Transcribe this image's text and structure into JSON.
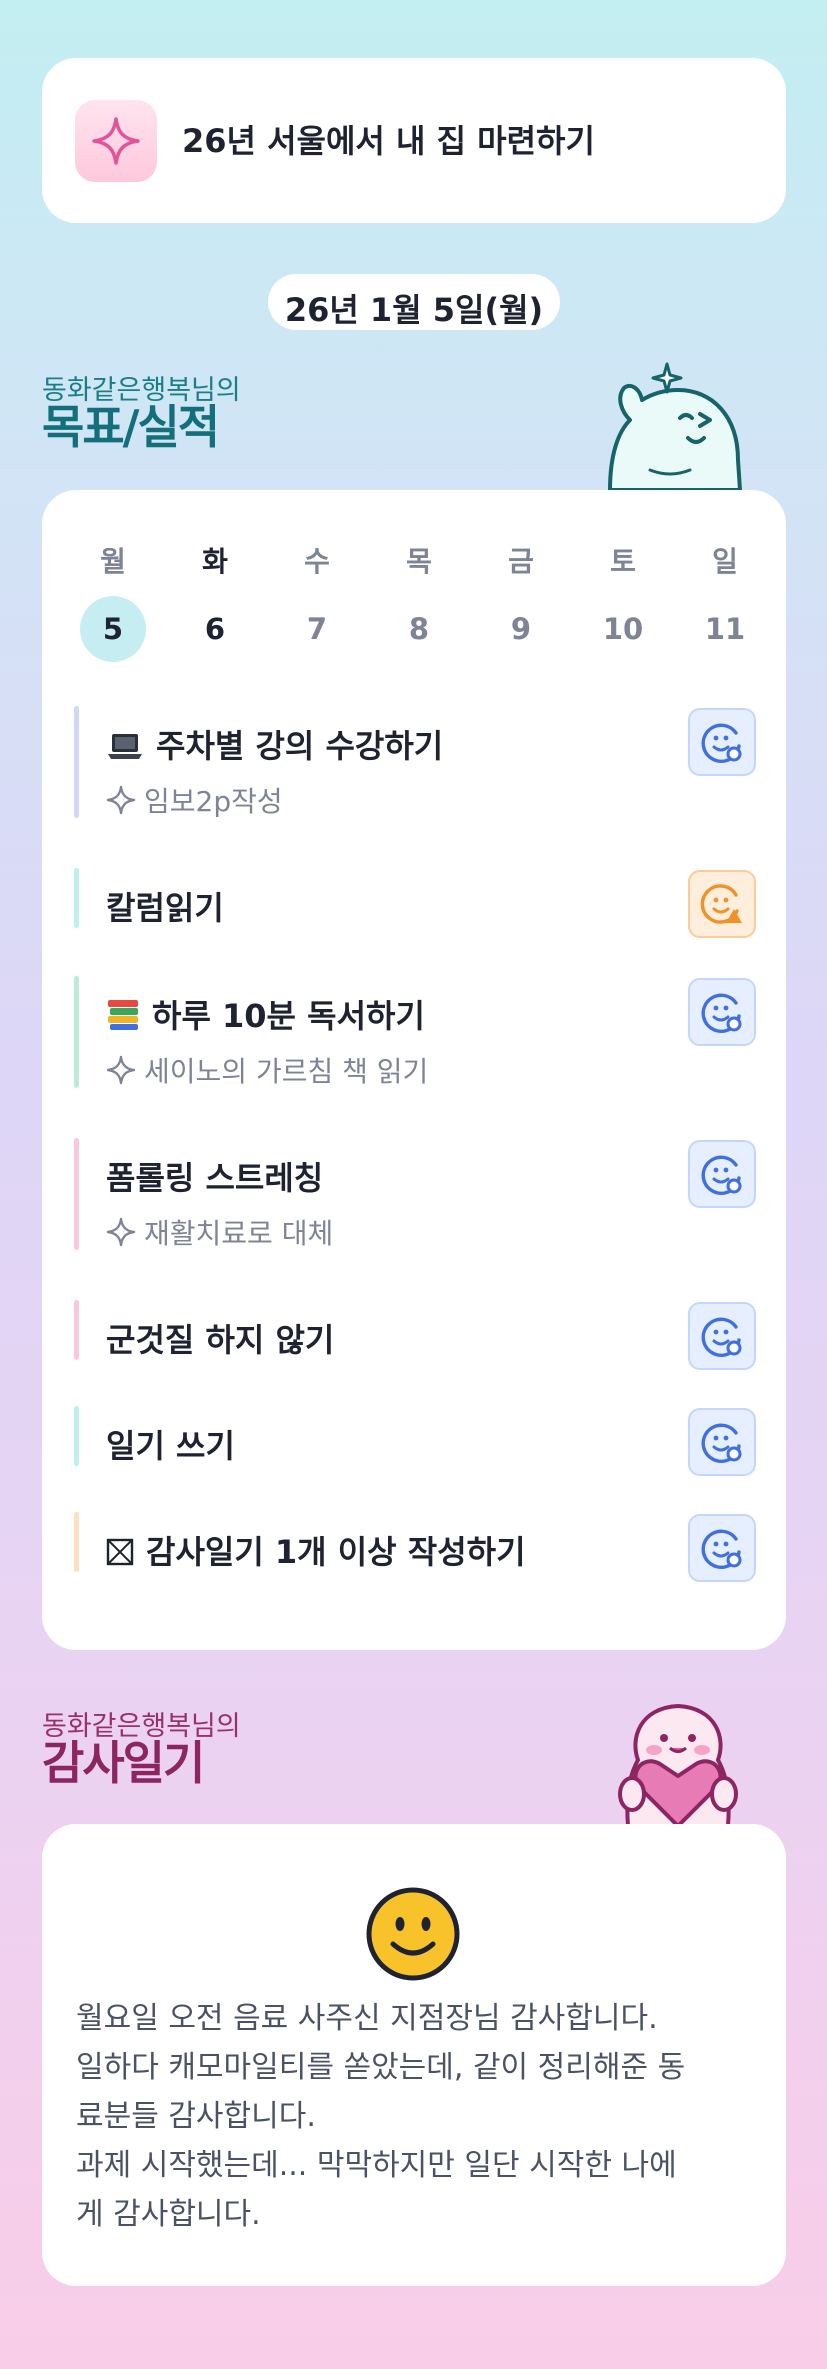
{
  "goal": {
    "title": "26년 서울에서 내 집 마련하기",
    "icon": "sparkle-icon"
  },
  "date": "26년 1월 5일(월)",
  "goals_section": {
    "subtitle": "동화같은행복님의",
    "title": "목표/실적"
  },
  "week": {
    "days": [
      {
        "label": "월",
        "date": "5",
        "selected": true
      },
      {
        "label": "화",
        "date": "6",
        "today": true
      },
      {
        "label": "수",
        "date": "7"
      },
      {
        "label": "목",
        "date": "8"
      },
      {
        "label": "금",
        "date": "9"
      },
      {
        "label": "토",
        "date": "10"
      },
      {
        "label": "일",
        "date": "11"
      }
    ]
  },
  "tasks": [
    {
      "title": "주차별 강의 수강하기",
      "lead_icon": "laptop-icon",
      "subtitle": "임보2p작성",
      "bar_color": "#cfd9f6",
      "status": "done-smile-icon",
      "status_color": "#3f6fe0"
    },
    {
      "title": "칼럼읽기",
      "bar_color": "#bfeef0",
      "status": "warning-smile-icon",
      "status_color": "#f09226"
    },
    {
      "title": "하루 10분 독서하기",
      "lead_icon": "books-icon",
      "subtitle": "세이노의 가르침 책 읽기",
      "bar_color": "#bfead8",
      "status": "done-smile-icon",
      "status_color": "#3f6fe0"
    },
    {
      "title": "폼롤링 스트레칭",
      "subtitle": "재활치료로 대체",
      "bar_color": "#f8c8dc",
      "status": "done-smile-icon",
      "status_color": "#3f6fe0"
    },
    {
      "title": "군것질 하지 않기",
      "bar_color": "#f8c8dc",
      "status": "done-smile-icon",
      "status_color": "#3f6fe0"
    },
    {
      "title": "일기 쓰기",
      "bar_color": "#bfeef0",
      "status": "done-smile-icon",
      "status_color": "#3f6fe0"
    },
    {
      "title": "감사일기 1개 이상 작성하기",
      "lead_icon": "checkbox-crossed-icon",
      "bar_color": "#fbe1bd",
      "status": "done-smile-icon",
      "status_color": "#3f6fe0"
    }
  ],
  "diary_section": {
    "subtitle": "동화같은행복님의",
    "title": "감사일기"
  },
  "diary": {
    "mood_icon": "smiley-face-icon",
    "lines": [
      "월요일 오전 음료 사주신 지점장님 감사합니다.",
      "일하다 캐모마일티를 쏟았는데, 같이 정리해준 동",
      "료분들 감사합니다.",
      "과제 시작했는데... 막막하지만 일단 시작한 나에",
      "게 감사합니다."
    ]
  }
}
